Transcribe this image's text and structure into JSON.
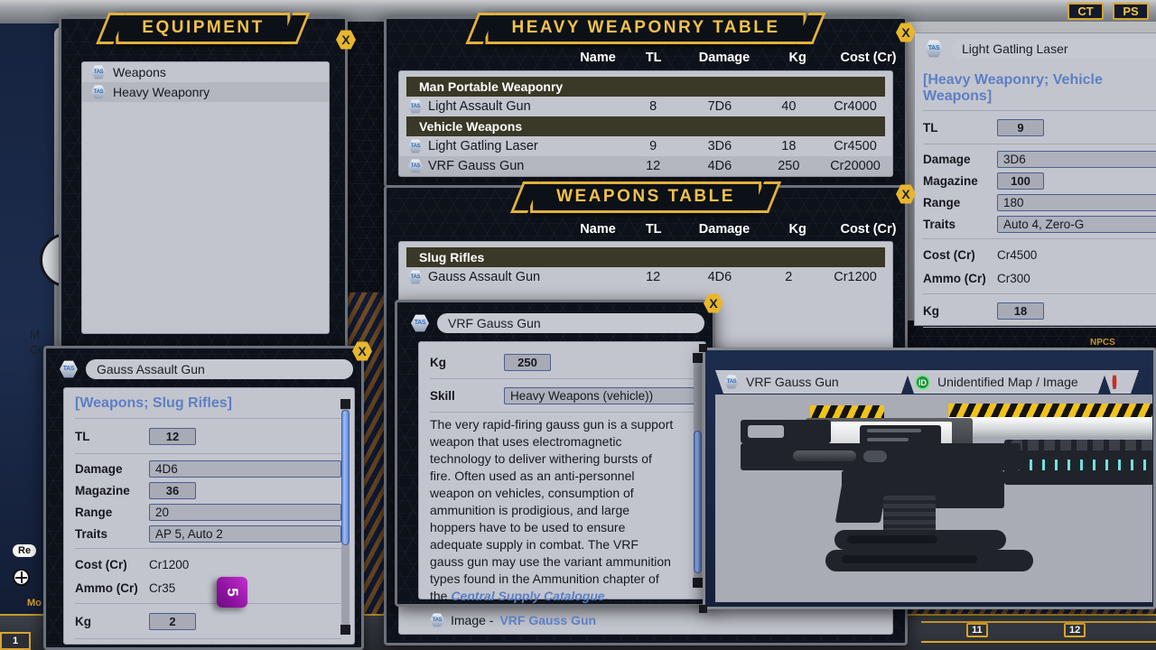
{
  "app": {
    "top_buttons": [
      {
        "label": "CT",
        "name": "ct-button"
      },
      {
        "label": "PS",
        "name": "ps-button"
      }
    ],
    "ruler_marks": [
      "11",
      "12"
    ],
    "hidden_left": {
      "line1": "M",
      "line2": "Co"
    },
    "hidden_pill": "Re",
    "hidden_mini": "Mo",
    "hidden_tab": "1",
    "npcs_label": "NPCS"
  },
  "equipment_window": {
    "title": "EQUIPMENT",
    "close_label": "X",
    "items": [
      {
        "label": "Weapons",
        "icon": "tas-icon",
        "selected": false
      },
      {
        "label": "Heavy Weaponry",
        "icon": "tas-icon",
        "selected": true
      }
    ]
  },
  "heavy_table": {
    "title": "HEAVY WEAPONRY TABLE",
    "close_label": "X",
    "columns": [
      "Name",
      "TL",
      "Damage",
      "Kg",
      "Cost (Cr)"
    ],
    "groups": [
      {
        "category": "Man Portable Weaponry",
        "rows": [
          {
            "name": "Light Assault Gun",
            "tl": "8",
            "damage": "7D6",
            "kg": "40",
            "cost": "Cr4000"
          }
        ]
      },
      {
        "category": "Vehicle Weapons",
        "rows": [
          {
            "name": "Light Gatling Laser",
            "tl": "9",
            "damage": "3D6",
            "kg": "18",
            "cost": "Cr4500"
          },
          {
            "name": "VRF Gauss Gun",
            "tl": "12",
            "damage": "4D6",
            "kg": "250",
            "cost": "Cr20000"
          }
        ]
      }
    ]
  },
  "weapons_table": {
    "title": "WEAPONS TABLE",
    "close_label": "X",
    "columns": [
      "Name",
      "TL",
      "Damage",
      "Kg",
      "Cost (Cr)"
    ],
    "groups": [
      {
        "category": "Slug Rifles",
        "rows": [
          {
            "name": "Gauss Assault Gun",
            "tl": "12",
            "damage": "4D6",
            "kg": "2",
            "cost": "Cr1200"
          }
        ]
      }
    ]
  },
  "vrf_sheet": {
    "close_label": "X",
    "item_name": "VRF Gauss Gun",
    "fields": [
      {
        "label": "Kg",
        "value": "250",
        "style": "button"
      },
      {
        "label": "Skill",
        "value": "Heavy Weapons (vehicle))",
        "style": "input"
      }
    ],
    "description": "The very rapid-firing gauss gun is a support weapon that uses electromagnetic technology to deliver withering bursts of fire. Often used as an anti-personnel weapon on vehicles, consumption of ammunition is prodigious, and large hoppers have to be used to ensure adequate supply in combat. The VRF gauss gun may use the variant ammunition types found in the Ammunition chapter of the ",
    "description_link": "Central Supply Catalogue",
    "description_tail": ".",
    "image_prefix": "Image - ",
    "image_link": "VRF Gauss Gun"
  },
  "gauss_sheet": {
    "close_label": "X",
    "item_name": "Gauss Assault Gun",
    "category": "[Weapons; Slug Rifles]",
    "fields": [
      {
        "label": "TL",
        "value": "12",
        "style": "button"
      },
      {
        "label": "Damage",
        "value": "4D6",
        "style": "input"
      },
      {
        "label": "Magazine",
        "value": "36",
        "style": "button"
      },
      {
        "label": "Range",
        "value": "20",
        "style": "input"
      },
      {
        "label": "Traits",
        "value": "AP 5, Auto 2",
        "style": "input"
      },
      {
        "label": "Cost (Cr)",
        "value": "Cr1200",
        "style": "plain"
      },
      {
        "label": "Ammo (Cr)",
        "value": "Cr35",
        "style": "plain"
      },
      {
        "label": "Kg",
        "value": "2",
        "style": "button"
      }
    ],
    "die_value": "5"
  },
  "gatling_sheet": {
    "item_name": "Light Gatling Laser",
    "category": "[Heavy Weaponry; Vehicle Weapons]",
    "fields": [
      {
        "label": "TL",
        "value": "9",
        "style": "button"
      },
      {
        "label": "Damage",
        "value": "3D6",
        "style": "input"
      },
      {
        "label": "Magazine",
        "value": "100",
        "style": "button"
      },
      {
        "label": "Range",
        "value": "180",
        "style": "input"
      },
      {
        "label": "Traits",
        "value": "Auto 4, Zero-G",
        "style": "input"
      },
      {
        "label": "Cost (Cr)",
        "value": "Cr4500",
        "style": "plain"
      },
      {
        "label": "Ammo (Cr)",
        "value": "Cr300",
        "style": "plain"
      },
      {
        "label": "Kg",
        "value": "18",
        "style": "button"
      }
    ]
  },
  "image_window": {
    "tabs": [
      {
        "label": "VRF Gauss Gun",
        "icon": "tas-icon",
        "active": true
      },
      {
        "label": "Unidentified Map / Image",
        "icon": "id-icon",
        "active": false
      },
      {
        "label": "",
        "icon": "red-hex-icon",
        "active": false
      }
    ],
    "image_alt": "VRF Gauss Gun artwork"
  },
  "colors": {
    "gold": "#e0b13c",
    "panel": "#c3c5ce",
    "category_bar": "#3a3826",
    "link": "#5c7fc4",
    "die": "#a017b8"
  }
}
